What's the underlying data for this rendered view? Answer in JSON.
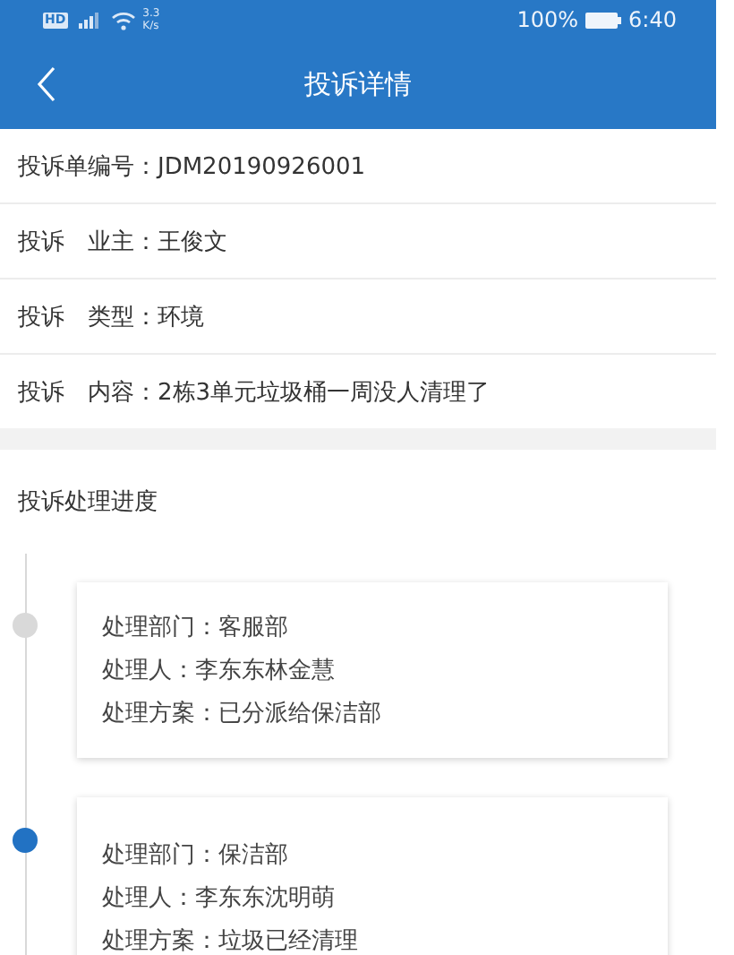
{
  "status_bar": {
    "hd": "HD",
    "speed_value": "3.3",
    "speed_unit": "K/s",
    "battery": "100%",
    "time": "6:40"
  },
  "header": {
    "title": "投诉详情"
  },
  "details": [
    "投诉单编号：JDM20190926001",
    "投诉　业主：王俊文",
    "投诉　类型：环境",
    "投诉　内容：2栋3单元垃圾桶一周没人清理了"
  ],
  "progress": {
    "title": "投诉处理进度",
    "steps": [
      {
        "active": false,
        "lines": [
          "处理部门：客服部",
          "处理人：李东东林金慧",
          "处理方案：已分派给保洁部"
        ]
      },
      {
        "active": true,
        "lines": [
          "处理部门：保洁部",
          "处理人：李东东沈明萌",
          "处理方案：垃圾已经清理"
        ]
      }
    ]
  }
}
